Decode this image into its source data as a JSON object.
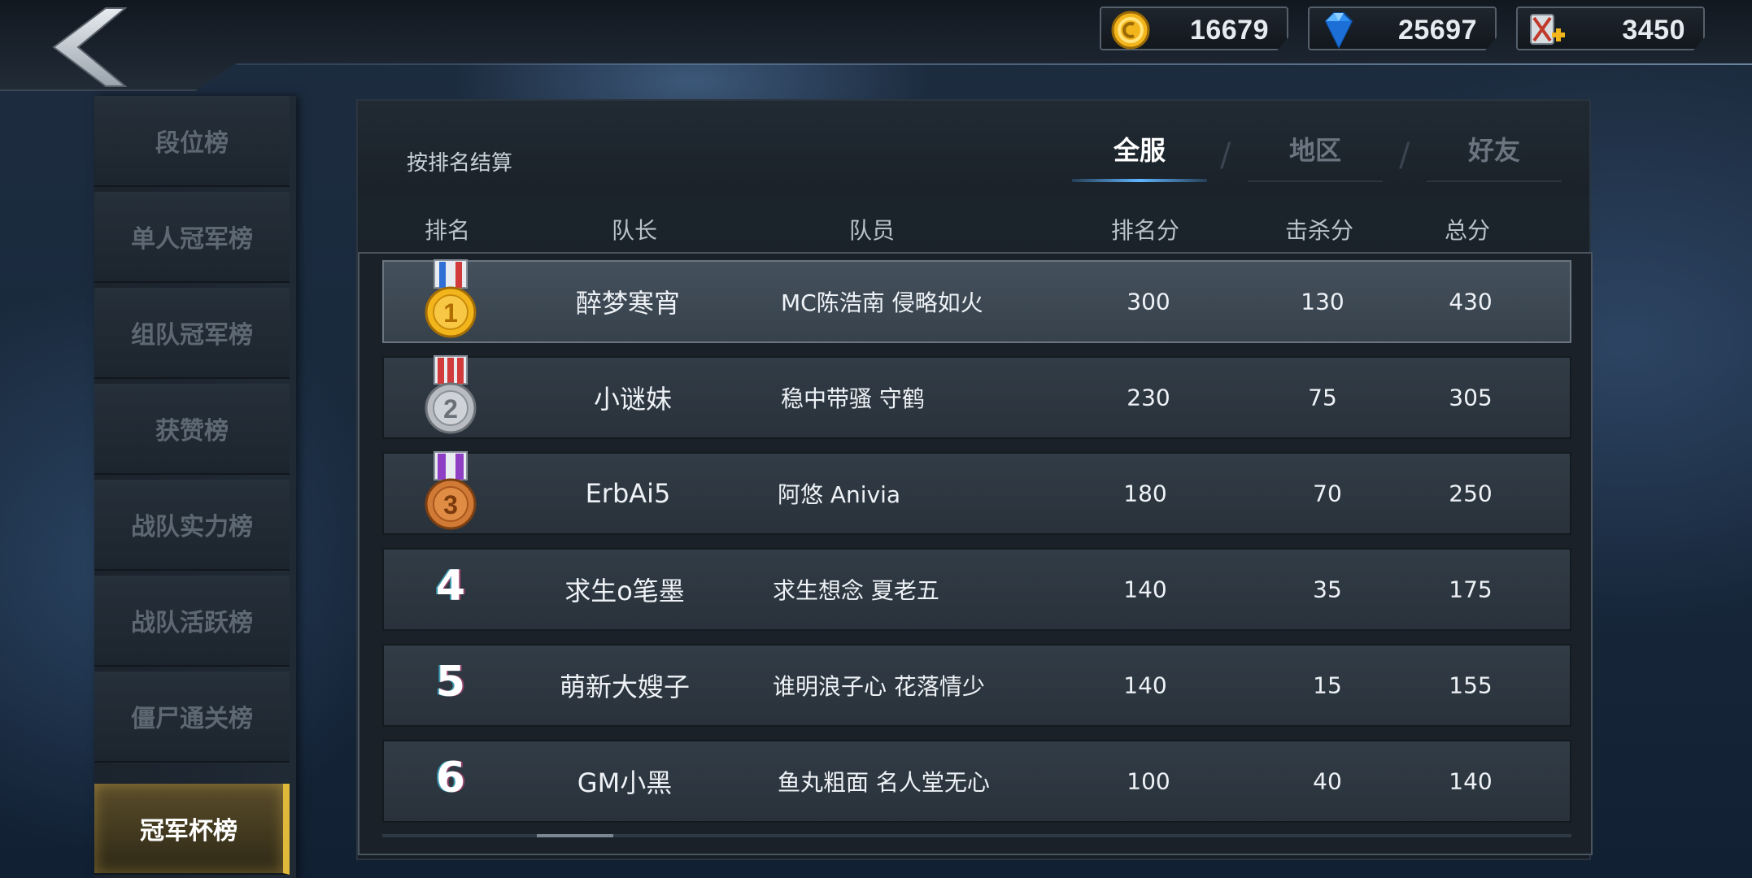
{
  "currencies": {
    "gold": {
      "icon": "gold-coin-icon",
      "amount": "16679"
    },
    "gem": {
      "icon": "diamond-icon",
      "amount": "25697"
    },
    "ticket": {
      "icon": "ticket-plus-icon",
      "amount": "3450"
    }
  },
  "sidebar": {
    "items": [
      {
        "label": "段位榜"
      },
      {
        "label": "单人冠军榜"
      },
      {
        "label": "组队冠军榜"
      },
      {
        "label": "获赞榜"
      },
      {
        "label": "战队实力榜"
      },
      {
        "label": "战队活跃榜"
      },
      {
        "label": "僵尸通关榜"
      },
      {
        "label": "冠军杯榜"
      }
    ],
    "active_index": 7
  },
  "header": {
    "settle_note": "按排名结算",
    "tabs": [
      {
        "label": "全服",
        "active": true
      },
      {
        "label": "地区",
        "active": false
      },
      {
        "label": "好友",
        "active": false
      }
    ],
    "separator": "/"
  },
  "columns": {
    "rank": "排名",
    "captain": "队长",
    "members": "队员",
    "rank_score": "排名分",
    "kill_score": "击杀分",
    "total": "总分"
  },
  "rows": [
    {
      "rank": "1",
      "medal": "gold-medal-icon",
      "captain": "醉梦寒宵",
      "members": "MC陈浩南   侵略如火",
      "rank_score": "300",
      "kill_score": "130",
      "total": "430"
    },
    {
      "rank": "2",
      "medal": "silver-medal-icon",
      "captain": "小谜妹",
      "members": "稳中带骚    守鹤",
      "rank_score": "230",
      "kill_score": "75",
      "total": "305"
    },
    {
      "rank": "3",
      "medal": "bronze-medal-icon",
      "captain": "ErbAi5",
      "members": "阿悠    Anivia",
      "rank_score": "180",
      "kill_score": "70",
      "total": "250"
    },
    {
      "rank": "4",
      "captain": "求生o笔墨",
      "members": "求生想念   夏老五",
      "rank_score": "140",
      "kill_score": "35",
      "total": "175"
    },
    {
      "rank": "5",
      "captain": "萌新大嫂子",
      "members": "谁明浪子心   花落情少",
      "rank_score": "140",
      "kill_score": "15",
      "total": "155"
    },
    {
      "rank": "6",
      "captain": "GM小黑",
      "members": "鱼丸粗面   名人堂无心",
      "rank_score": "100",
      "kill_score": "40",
      "total": "140"
    }
  ],
  "colors": {
    "accent_blue": "#5fb4ff",
    "active_gold": "#e0b83a",
    "gold_medal": "#f3b51c",
    "silver_medal": "#b8bcc2",
    "bronze_medal": "#d07a36"
  }
}
